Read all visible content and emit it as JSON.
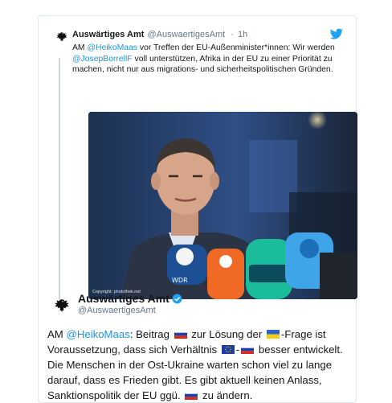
{
  "quoted_tweet": {
    "author_name": "Auswärtiges Amt",
    "author_handle": "@AuswaertigesAmt",
    "separator": "·",
    "time": "1h",
    "text_parts": {
      "prefix": "AM ",
      "mention1": "@HeikoMaas",
      "mid1": " vor Treffen der EU-Außenminister*innen: Wir werden ",
      "mention2": "@JosepBorrellF",
      "rest": " voll unterstützen, Afrika in der EU zu einer Priorität zu machen, nicht nur aus migrations- und sicherheitspolitischen Gründen."
    },
    "photo_credit": "Copyright: photothek.net"
  },
  "main_tweet": {
    "author_name": "Auswärtiges Amt",
    "author_handle": "@AuswaertigesAmt",
    "text": {
      "p1": "AM ",
      "mention": "@HeikoMaas",
      "p2": ": Beitrag ",
      "p3": " zur Lösung der ",
      "p4": "-Frage ist Voraussetzung, dass sich Verhältnis ",
      "p5": "-",
      "p6": " besser entwickelt. Die Menschen in der Ost-Ukraine warten schon viel zu lange darauf, dass es Frieden gibt. Es gibt aktuell keinen Anlass, Sanktionspolitik der EU ggü. ",
      "p7": " zu ändern."
    }
  },
  "colors": {
    "link": "#1b95e0",
    "twitter_blue": "#1da1f2",
    "secondary_text": "#657786",
    "border": "#e1e8ed"
  },
  "icons": [
    "crest-icon",
    "twitter-bird-icon",
    "verified-badge-icon",
    "flag-russia-icon",
    "flag-ukraine-icon",
    "flag-eu-icon"
  ]
}
